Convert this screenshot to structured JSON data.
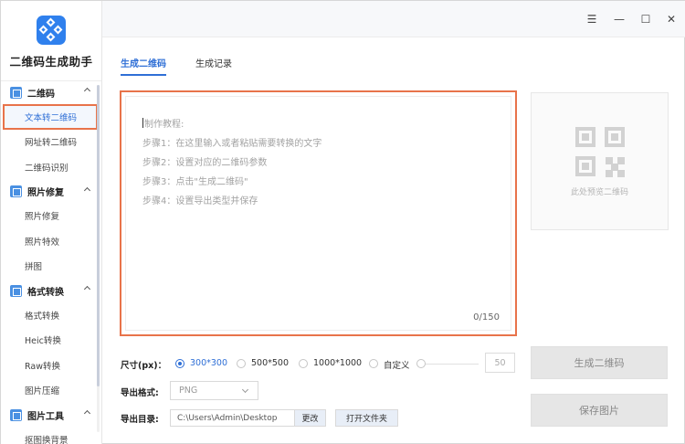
{
  "app": {
    "title": "二维码生成助手",
    "brand_color": "#2f80ed",
    "accent_color": "#2f6fd6",
    "highlight_color": "#e8734a"
  },
  "window_controls": {
    "menu": "☰",
    "minimize": "—",
    "maximize": "☐",
    "close": "✕"
  },
  "sidebar": {
    "groups": [
      {
        "label": "二维码",
        "icon": "qrcode-icon",
        "items": [
          "文本转二维码",
          "网址转二维码",
          "二维码识别"
        ]
      },
      {
        "label": "照片修复",
        "icon": "photo-icon",
        "items": [
          "照片修复",
          "照片特效",
          "拼图"
        ]
      },
      {
        "label": "格式转换",
        "icon": "convert-icon",
        "items": [
          "格式转换",
          "Heic转换",
          "Raw转换",
          "图片压缩"
        ]
      },
      {
        "label": "图片工具",
        "icon": "image-tools-icon",
        "items": [
          "抠图换背景"
        ]
      }
    ],
    "active_item": "文本转二维码"
  },
  "tabs": {
    "generate": "生成二维码",
    "history": "生成记录"
  },
  "editor": {
    "lines": [
      "制作教程:",
      "步骤1：在这里输入或者粘贴需要转换的文字",
      "步骤2：设置对应的二维码参数",
      "步骤3：点击\"生成二维码\"",
      "步骤4：设置导出类型并保存"
    ],
    "counter": "0/150"
  },
  "preview": {
    "placeholder": "此处预览二维码"
  },
  "options": {
    "size_label": "尺寸(px)：",
    "sizes": [
      "300*300",
      "500*500",
      "1000*1000",
      "自定义"
    ],
    "selected_size": "300*300",
    "custom_value": "50",
    "format_label": "导出格式:",
    "format_value": "PNG",
    "dir_label": "导出目录:",
    "dir_value": "C:\\Users\\Admin\\Desktop",
    "change_label": "更改",
    "open_folder_label": "打开文件夹"
  },
  "actions": {
    "generate": "生成二维码",
    "save": "保存图片"
  }
}
